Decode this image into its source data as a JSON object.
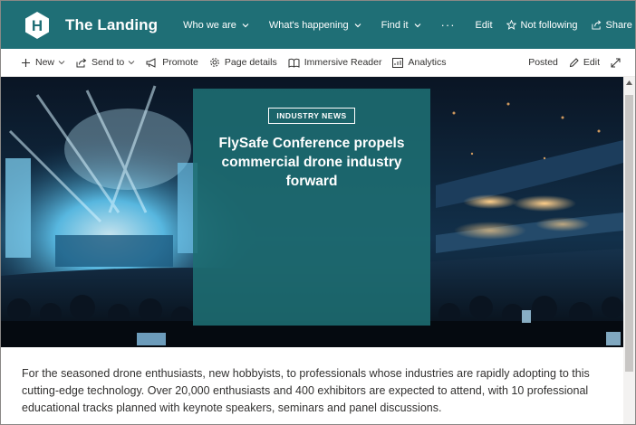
{
  "header": {
    "site_title": "The Landing",
    "logo_letter": "H",
    "brand_color": "#1f6f76",
    "nav": [
      {
        "label": "Who we are",
        "has_dropdown": true
      },
      {
        "label": "What's happening",
        "has_dropdown": true
      },
      {
        "label": "Find it",
        "has_dropdown": true
      }
    ],
    "more": "···",
    "edit_label": "Edit",
    "follow_label": "Not following",
    "share_label": "Share"
  },
  "commandbar": {
    "new_label": "New",
    "send_to_label": "Send to",
    "promote_label": "Promote",
    "page_details_label": "Page details",
    "immersive_reader_label": "Immersive Reader",
    "analytics_label": "Analytics",
    "status_label": "Posted",
    "edit_label": "Edit"
  },
  "hero": {
    "tag": "INDUSTRY NEWS",
    "title": "FlySafe Conference propels commercial drone industry forward",
    "panel_color": "#1e6e73"
  },
  "article": {
    "body": "For the seasoned drone enthusiasts, new hobbyists, to professionals whose industries are rapidly adopting to this cutting-edge technology. Over 20,000 enthusiasts and 400 exhibitors are expected to attend, with 10 professional educational tracks planned with keynote speakers, seminars and panel discussions."
  }
}
